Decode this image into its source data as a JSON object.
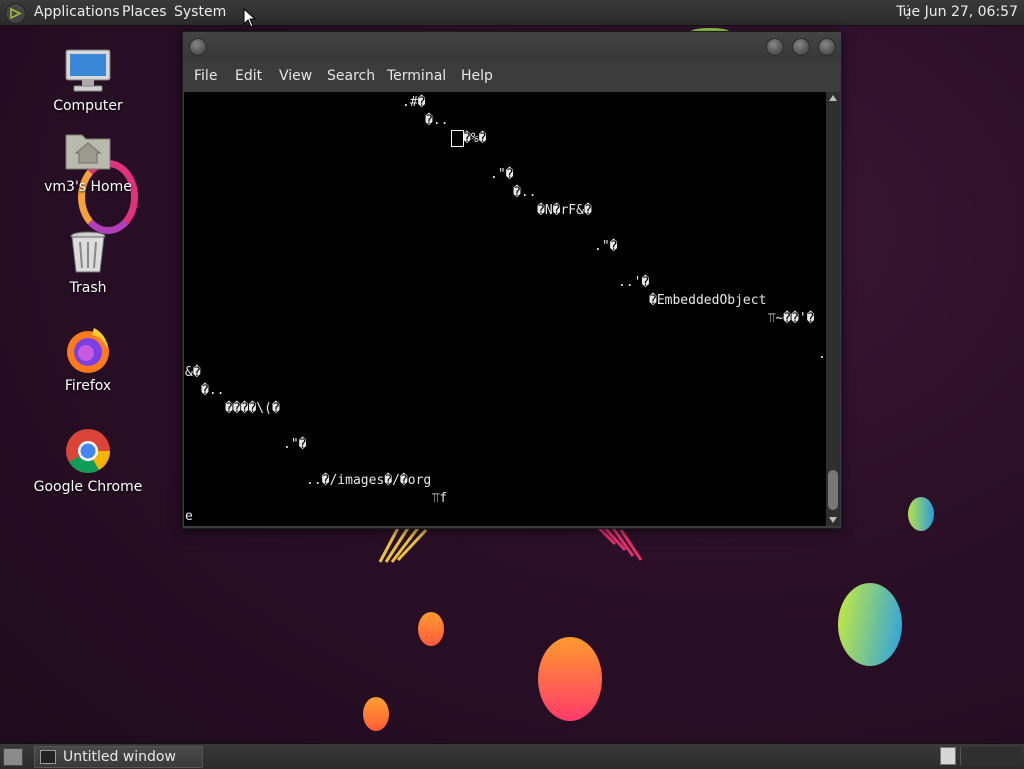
{
  "top_panel": {
    "menus": [
      "Applications",
      "Places",
      "System"
    ],
    "clock": "Tue Jun 27, 06:57"
  },
  "desktop_icons": [
    {
      "label": "Computer",
      "icon": "computer-icon"
    },
    {
      "label": "vm3's Home",
      "icon": "home-folder-icon"
    },
    {
      "label": "Trash",
      "icon": "trash-icon"
    },
    {
      "label": "Firefox",
      "icon": "firefox-icon"
    },
    {
      "label": "Google Chrome",
      "icon": "chrome-icon"
    }
  ],
  "terminal_window": {
    "menu": [
      "File",
      "Edit",
      "View",
      "Search",
      "Terminal",
      "Help"
    ],
    "lines": [
      ".#�",
      "�..",
      "�%�",
      ".\"�",
      "�..",
      "�N�rF&�",
      ".\"�",
      "..'�",
      "�EmbeddedObject",
      "⫪~��'�",
      ".",
      "&�",
      "�..",
      "����\\(�",
      ".\"�",
      "..�/images�/�org",
      "⫪f",
      "e"
    ]
  },
  "taskbar": {
    "window_button_label": "Untitled window"
  },
  "colors": {
    "panel": "#2f2f2f",
    "terminal_bg": "#000000",
    "terminal_fg": "#e8e8e8",
    "wallpaper": "#2a0f26"
  }
}
